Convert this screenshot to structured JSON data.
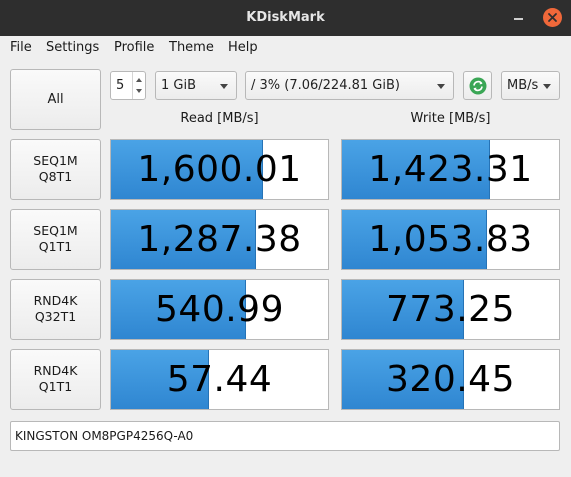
{
  "window": {
    "title": "KDiskMark"
  },
  "menu": [
    "File",
    "Settings",
    "Profile",
    "Theme",
    "Help"
  ],
  "controls": {
    "all_label": "All",
    "loops": "5",
    "file_size": "1 GiB",
    "target": "/ 3% (7.06/224.81 GiB)",
    "unit": "MB/s"
  },
  "headers": {
    "read": "Read [MB/s]",
    "write": "Write [MB/s]"
  },
  "tests": [
    {
      "line1": "SEQ1M",
      "line2": "Q8T1",
      "read": "1,600.01",
      "write": "1,423.31",
      "read_fill": 0.7,
      "write_fill": 0.68
    },
    {
      "line1": "SEQ1M",
      "line2": "Q1T1",
      "read": "1,287.38",
      "write": "1,053.83",
      "read_fill": 0.67,
      "write_fill": 0.67
    },
    {
      "line1": "RND4K",
      "line2": "Q32T1",
      "read": "540.99",
      "write": "773.25",
      "read_fill": 0.62,
      "write_fill": 0.56
    },
    {
      "line1": "RND4K",
      "line2": "Q1T1",
      "read": "57.44",
      "write": "320.45",
      "read_fill": 0.45,
      "write_fill": 0.56
    }
  ],
  "device": "KINGSTON OM8PGP4256Q-A0",
  "colors": {
    "bar": "#2f86d1",
    "titlebar": "#2e2e2e",
    "close": "#f0683a",
    "refresh": "#3aa655"
  }
}
